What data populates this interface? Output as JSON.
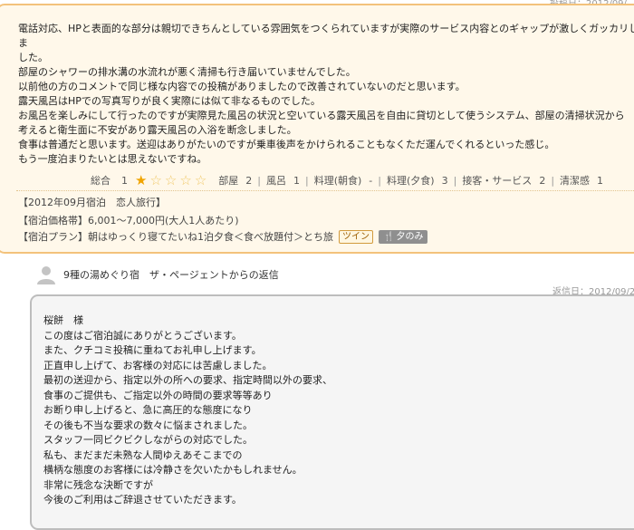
{
  "review": {
    "post_date": "投稿日：2012/09/",
    "body_lines": [
      "電話対応、HPと表面的な部分は親切できちんとしている雰囲気をつくられていますが実際のサービス内容とのギャップが激しくガッカリしま",
      "した。",
      "部屋のシャワーの排水溝の水流れが悪く清掃も行き届いていませんでした。",
      "以前他の方のコメントで同じ様な内容での投稿がありましたので改善されていないのだと思います。",
      "露天風呂はHPでの写真写りが良く実際には似て非なるものでした。",
      "お風呂を楽しみにして行ったのですが実際見た風呂の状況と空いている露天風呂を自由に貸切として使うシステム、部屋の清掃状況から",
      "考えると衛生面に不安があり露天風呂の入浴を断念しました。",
      "食事は普通だと思います。送迎はありがたいのですが乗車後声をかけられることもなくただ運んでくれるといった感じ。",
      "もう一度泊まりたいとは思えないですね。"
    ],
    "rating": {
      "overall_label": "総合",
      "overall_value": "1",
      "stars_filled": 1,
      "stars_total": 5,
      "room_label": "部屋",
      "room_value": "2",
      "bath_label": "風呂",
      "bath_value": "1",
      "breakfast_label": "料理(朝食)",
      "breakfast_value": "-",
      "dinner_label": "料理(夕食)",
      "dinner_value": "3",
      "service_label": "接客・サービス",
      "service_value": "2",
      "cleanliness_label": "清潔感",
      "cleanliness_value": "1"
    },
    "stay_info": "【2012年09月宿泊　恋人旅行】",
    "price_info": "【宿泊価格帯】6,001～7,000円(大人1人あたり)",
    "plan_info": "【宿泊プラン】朝はゆっくり寝てたいね1泊夕食＜食べ放題付＞とち旅",
    "badge_twin": "ツイン",
    "badge_meal": "夕のみ"
  },
  "reply": {
    "author": "9種の湯めぐり宿　ザ・ページェントからの返信",
    "date": "返信日：2012/09/2",
    "body_lines": [
      "桜餅　様",
      "この度はご宿泊誠にありがとうございます。",
      "また、クチコミ投稿に重ねてお礼申し上げます。",
      "正直申し上げて、お客様の対応には苦慮しました。",
      "最初の送迎から、指定以外の所への要求、指定時間以外の要求、",
      "食事のご提供も、ご指定以外の時間の要求等等あり",
      "お断り申し上げると、急に高圧的な態度になり",
      "その後も不当な要求の数々に悩まされました。",
      "スタッフ一同ビクビクしながらの対応でした。",
      "私も、まだまだ未熟な人間ゆえあそこまでの",
      "横柄な態度のお客様には冷静さを欠いたかもしれません。",
      "非常に残念な決断ですが",
      "今後のご利用はご辞退させていただきます。"
    ]
  },
  "icons": {
    "star": "star-icon",
    "person": "person-icon",
    "fork": "fork-knife-icon"
  },
  "colors": {
    "review_bg": "#fff8ea",
    "review_border": "#f3c27b",
    "star_filled": "#f0a400",
    "reply_bg": "#f5f5f5",
    "reply_border": "#bdbdbd"
  }
}
